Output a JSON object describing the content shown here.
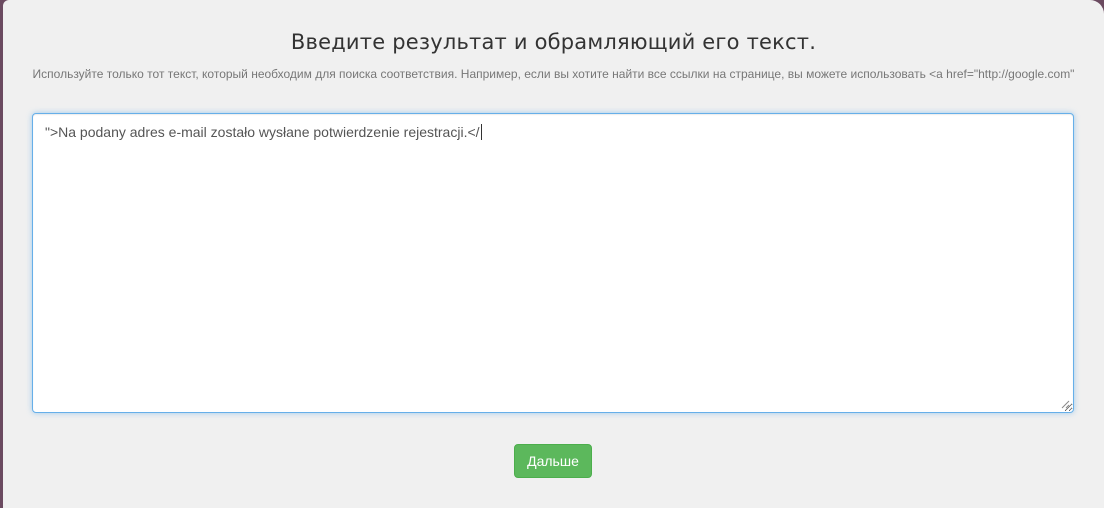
{
  "form": {
    "title": "Введите результат и обрамляющий его текст.",
    "hint": "Используйте только тот текст, который необходим для поиска соответствия. Например, если вы хотите найти все ссылки на странице, вы можете использовать <a href=\"http://google.com\"",
    "textarea_value": "\">Na podany adres e-mail zostało wysłane potwierdzenie rejestracji.</",
    "next_label": "Дальше"
  },
  "colors": {
    "next_button": "#5cb85c",
    "focus_border": "#66afe9",
    "background": "#f0f0f0"
  }
}
